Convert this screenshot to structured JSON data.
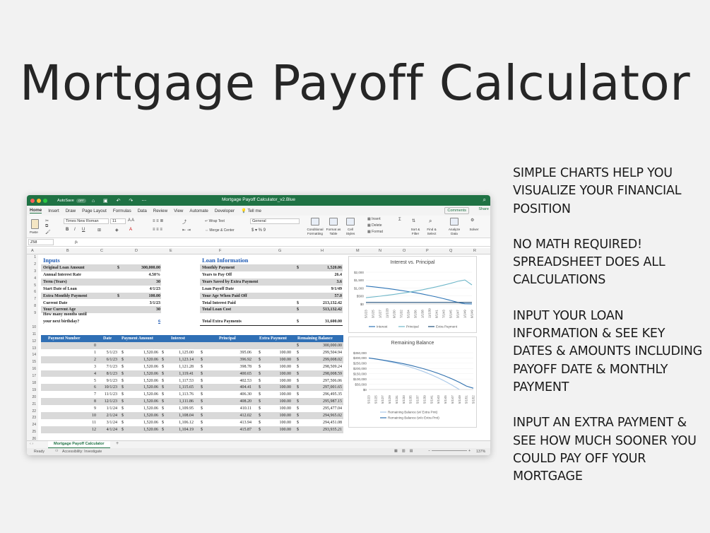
{
  "slide": {
    "title": "Mortgage Payoff Calculator",
    "paragraphs": [
      "SIMPLE CHARTS HELP YOU VISUALIZE YOUR FINANCIAL POSITION",
      "NO MATH REQUIRED! SPREADSHEET DOES ALL CALCULATIONS",
      "INPUT YOUR LOAN INFORMATION & SEE KEY DATES & AMOUNTS INCLUDING PAYOFF DATE & MONTHLY PAYMENT",
      "INPUT AN EXTRA PAYMENT & SEE HOW MUCH SOONER YOU COULD PAY OFF YOUR MORTGAGE"
    ]
  },
  "window": {
    "autosave_label": "AutoSave",
    "autosave_state": "OFF",
    "doc_title": "Mortgage Payoff Calculator_v2.Blue",
    "tabs": [
      "Home",
      "Insert",
      "Draw",
      "Page Layout",
      "Formulas",
      "Data",
      "Review",
      "View",
      "Automate",
      "Developer",
      "Tell me"
    ],
    "comments": "Comments",
    "share": "Share",
    "ribbon": {
      "paste": "Paste",
      "font_name": "Times New Roman",
      "font_size": "11",
      "wrap_text": "Wrap Text",
      "merge_center": "Merge & Center",
      "number_format": "General",
      "conditional": "Conditional Formatting",
      "format_table": "Format as Table",
      "cell_styles": "Cell Styles",
      "insert": "Insert",
      "delete": "Delete",
      "format": "Format",
      "sort_filter": "Sort & Filter",
      "find_select": "Find & Select",
      "analyze": "Analyze Data",
      "solver": "Solver"
    },
    "name_box": "Z58",
    "fx": "fx",
    "columns": [
      "A",
      "B",
      "C",
      "D",
      "E",
      "F",
      "G",
      "H",
      "M",
      "N",
      "O",
      "P",
      "Q",
      "R"
    ],
    "rows": [
      "1",
      "2",
      "3",
      "4",
      "5",
      "6",
      "7",
      "8",
      "9",
      "",
      "10",
      "11",
      "12",
      "13",
      "14",
      "15",
      "16",
      "17",
      "18",
      "19",
      "20",
      "21",
      "22",
      "23",
      "24",
      "25",
      "26"
    ],
    "sheet_tab": "Mortgage Payoff Calculator",
    "status_ready": "Ready",
    "status_access": "Accessibility: Investigate",
    "zoom": "137%"
  },
  "inputs": {
    "title": "Inputs",
    "rows": [
      {
        "label": "Original Loan Amount",
        "cur": "$",
        "value": "300,000.00",
        "shade": true
      },
      {
        "label": "Annual Interest Rate",
        "cur": "",
        "value": "4.50%",
        "shade": false
      },
      {
        "label": "Term (Years)",
        "cur": "",
        "value": "30",
        "shade": true
      },
      {
        "label": "Start Date of Loan",
        "cur": "",
        "value": "4/1/23",
        "shade": false
      },
      {
        "label": "Extra Monthly Payment",
        "cur": "$",
        "value": "100.00",
        "shade": true
      },
      {
        "label": "Current Date",
        "cur": "",
        "value": "3/1/23",
        "shade": false
      },
      {
        "label": "Your Current Age",
        "cur": "",
        "value": "30",
        "shade": true
      }
    ],
    "months_label_1": "How many months until",
    "months_label_2": "your next birthday?",
    "months_value": "6"
  },
  "loan_info": {
    "title": "Loan Information",
    "rows": [
      {
        "label": "Monthly Payment",
        "cur": "$",
        "value": "1,520.06",
        "shade": true
      },
      {
        "label": "Years to Pay Off",
        "cur": "",
        "value": "26.4",
        "shade": false
      },
      {
        "label": "Years Saved by Extra Payment",
        "cur": "",
        "value": "3.6",
        "shade": true
      },
      {
        "label": "Loan Payoff Date",
        "cur": "",
        "value": "9/1/49",
        "shade": false
      },
      {
        "label": "Your Age When Paid Off",
        "cur": "",
        "value": "57.0",
        "shade": true
      },
      {
        "label": "Total Interest Paid",
        "cur": "$",
        "value": "213,132.42",
        "shade": false
      },
      {
        "label": "Total Loan Cost",
        "cur": "$",
        "value": "513,132.42",
        "shade": true
      }
    ],
    "extra_label": "Total Extra Payments",
    "extra_cur": "$",
    "extra_value": "31,600.00"
  },
  "schedule": {
    "headers": [
      "Payment Number",
      "Date",
      "Payment Amount",
      "Interest",
      "Principal",
      "Extra Payment",
      "Remaining Balance"
    ],
    "first_row": {
      "num": "0",
      "balance": "300,000.00"
    },
    "rows": [
      [
        "1",
        "5/1/23",
        "1,520.06",
        "1,125.00",
        "395.06",
        "100.00",
        "299,504.94"
      ],
      [
        "2",
        "6/1/23",
        "1,520.06",
        "1,123.14",
        "396.92",
        "100.00",
        "299,008.02"
      ],
      [
        "3",
        "7/1/23",
        "1,520.06",
        "1,121.28",
        "398.78",
        "100.00",
        "298,509.24"
      ],
      [
        "4",
        "8/1/23",
        "1,520.06",
        "1,119.41",
        "400.65",
        "100.00",
        "298,008.59"
      ],
      [
        "5",
        "9/1/23",
        "1,520.06",
        "1,117.53",
        "402.53",
        "100.00",
        "297,506.06"
      ],
      [
        "6",
        "10/1/23",
        "1,520.06",
        "1,115.65",
        "404.41",
        "100.00",
        "297,001.65"
      ],
      [
        "7",
        "11/1/23",
        "1,520.06",
        "1,113.76",
        "406.30",
        "100.00",
        "296,495.35"
      ],
      [
        "8",
        "12/1/23",
        "1,520.06",
        "1,111.86",
        "408.20",
        "100.00",
        "295,987.15"
      ],
      [
        "9",
        "1/1/24",
        "1,520.06",
        "1,109.95",
        "410.11",
        "100.00",
        "295,477.04"
      ],
      [
        "10",
        "2/1/24",
        "1,520.06",
        "1,108.04",
        "412.02",
        "100.00",
        "294,965.02"
      ],
      [
        "11",
        "3/1/24",
        "1,520.06",
        "1,106.12",
        "413.94",
        "100.00",
        "294,451.08"
      ],
      [
        "12",
        "4/1/24",
        "1,520.06",
        "1,104.19",
        "415.87",
        "100.00",
        "293,935.21"
      ]
    ]
  },
  "chart_data": [
    {
      "type": "line",
      "title": "Interest vs. Principal",
      "x": [
        "5/1/23",
        "3/1/25",
        "1/1/27",
        "11/1/28",
        "9/1/30",
        "7/1/32",
        "5/1/34",
        "3/1/36",
        "1/1/38",
        "11/1/39",
        "9/1/41",
        "7/1/43",
        "5/1/45",
        "3/1/47",
        "1/1/49",
        "9/1/49"
      ],
      "ylim": [
        0,
        2000
      ],
      "yticks": [
        "$2,000",
        "$1,500",
        "$1,000",
        "$500",
        "$0"
      ],
      "series": [
        {
          "name": "Interest",
          "color": "#2e75b6",
          "values": [
            1125,
            1080,
            1030,
            975,
            915,
            850,
            780,
            705,
            625,
            535,
            440,
            335,
            220,
            100,
            15,
            5
          ]
        },
        {
          "name": "Principal",
          "color": "#6fb7c9",
          "values": [
            395,
            440,
            490,
            545,
            605,
            670,
            740,
            815,
            895,
            985,
            1080,
            1185,
            1300,
            1420,
            1505,
            1200
          ]
        },
        {
          "name": "Extra Payment",
          "color": "#1f4e79",
          "values": [
            100,
            100,
            100,
            100,
            100,
            100,
            100,
            100,
            100,
            100,
            100,
            100,
            100,
            100,
            100,
            100
          ]
        }
      ]
    },
    {
      "type": "line",
      "title": "Remaining Balance",
      "x": [
        "5/1/23",
        "5/1/25",
        "5/1/27",
        "5/1/29",
        "5/1/31",
        "5/1/33",
        "5/1/35",
        "5/1/37",
        "5/1/39",
        "5/1/41",
        "5/1/43",
        "5/1/45",
        "5/1/47",
        "5/1/49",
        "5/1/51",
        "5/1/52"
      ],
      "ylim": [
        0,
        350000
      ],
      "yticks": [
        "$350,000",
        "$300,000",
        "$250,000",
        "$200,000",
        "$150,000",
        "$100,000",
        "$50,000",
        "$0"
      ],
      "series": [
        {
          "name": "Remaining Balance (w/ Extra Pmt)",
          "color": "#a9c8e8",
          "values": [
            300000,
            290000,
            278000,
            264000,
            249000,
            232000,
            213000,
            191000,
            167000,
            140000,
            110000,
            77000,
            40000,
            0,
            null,
            null
          ]
        },
        {
          "name": "Remaining Balance (w/o Extra Pmt)",
          "color": "#2e6fad",
          "values": [
            300000,
            291000,
            281000,
            270000,
            258000,
            245000,
            230000,
            213000,
            195000,
            175000,
            152000,
            127000,
            99000,
            68000,
            33000,
            12000
          ]
        }
      ]
    }
  ]
}
